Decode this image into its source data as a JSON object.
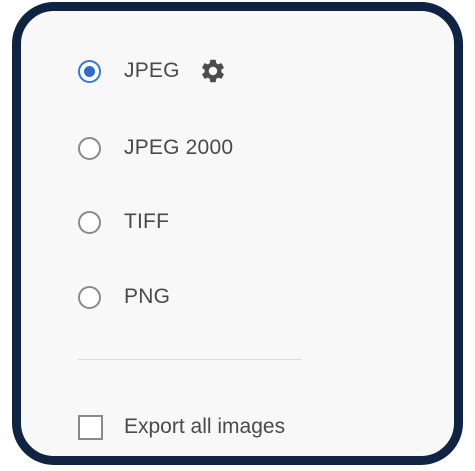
{
  "format_options": [
    {
      "label": "JPEG",
      "selected": true,
      "has_settings": true,
      "settings_icon": "gear-icon"
    },
    {
      "label": "JPEG 2000",
      "selected": false
    },
    {
      "label": "TIFF",
      "selected": false
    },
    {
      "label": "PNG",
      "selected": false
    }
  ],
  "export_all_images": {
    "label": "Export all images",
    "checked": false
  },
  "colors": {
    "frame": "#0f2343",
    "panel_background": "#f8f8f8",
    "radio_selected": "#2f6ec8",
    "control_border": "#8a8a8a",
    "text": "#4a4a4a",
    "divider": "#dcdcdc"
  }
}
